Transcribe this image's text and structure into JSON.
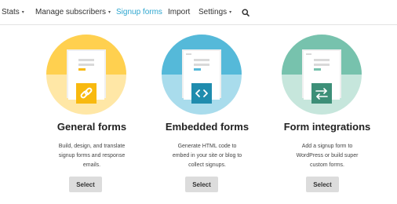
{
  "nav": {
    "items": [
      {
        "label": "Stats",
        "dropdown": true
      },
      {
        "label": "Manage subscribers",
        "dropdown": true
      },
      {
        "label": "Signup forms",
        "dropdown": false,
        "active": true
      },
      {
        "label": "Import",
        "dropdown": false
      },
      {
        "label": "Settings",
        "dropdown": true
      }
    ],
    "caret": "▾",
    "search_icon": "search-icon",
    "active_color": "#2ea6cf"
  },
  "cards": [
    {
      "title": "General forms",
      "desc": [
        "Build, design, and translate",
        "signup forms and response",
        "emails."
      ],
      "button": "Select",
      "icon": "link-icon",
      "colors": {
        "top": "#ffd04f",
        "bottom": "#ffe7a6",
        "badge": "#f8b90f"
      }
    },
    {
      "title": "Embedded forms",
      "desc": [
        "Generate HTML code to",
        "embed in your site or blog to",
        "collect signups."
      ],
      "button": "Select",
      "icon": "code-icon",
      "colors": {
        "top": "#55b9d9",
        "bottom": "#a9dcec",
        "badge": "#1f8cae"
      }
    },
    {
      "title": "Form integrations",
      "desc": [
        "Add a signup form to",
        "WordPress or build super",
        "custom forms."
      ],
      "button": "Select",
      "icon": "exchange-arrows-icon",
      "colors": {
        "top": "#77c2ad",
        "bottom": "#c6e6dc",
        "badge": "#3d8f78"
      }
    }
  ]
}
